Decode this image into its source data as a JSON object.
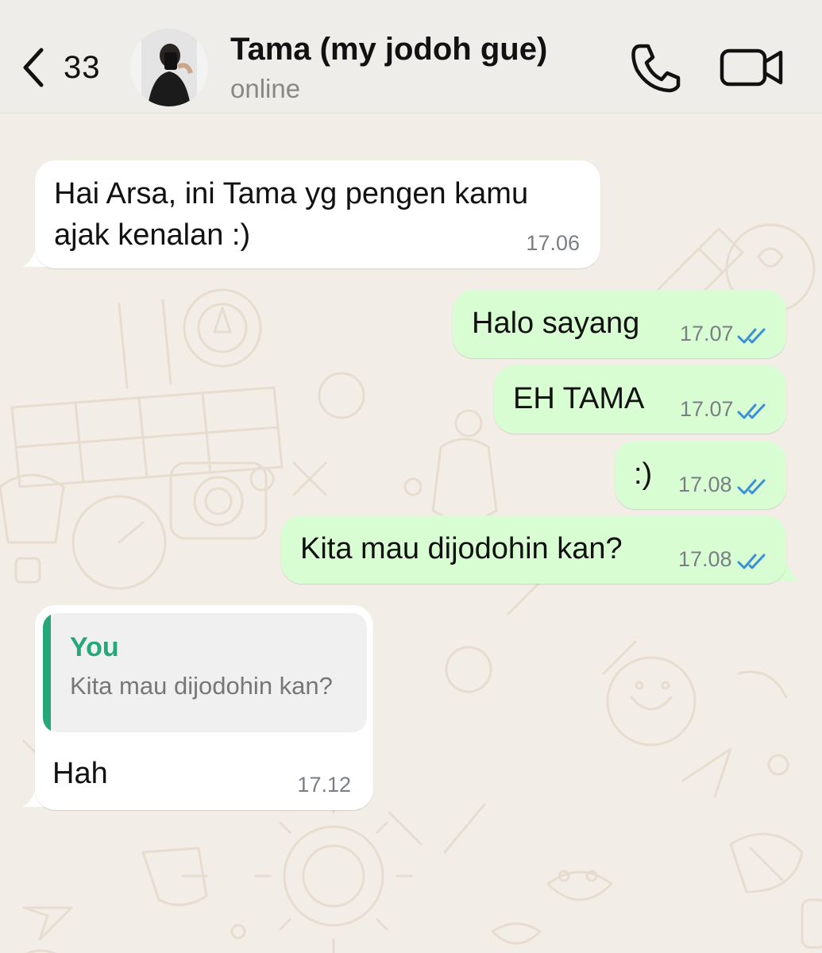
{
  "header": {
    "back_count": "33",
    "contact_name": "Tama (my jodoh gue)",
    "status": "online"
  },
  "messages": [
    {
      "direction": "incoming",
      "line1": "Hai Arsa, ini Tama yg pengen kamu",
      "line2": "ajak kenalan :)",
      "time": "17.06"
    },
    {
      "direction": "outgoing",
      "text": "Halo sayang",
      "time": "17.07",
      "status": "read"
    },
    {
      "direction": "outgoing",
      "text": "EH TAMA",
      "time": "17.07",
      "status": "read"
    },
    {
      "direction": "outgoing",
      "text": ":)",
      "time": "17.08",
      "status": "read"
    },
    {
      "direction": "outgoing",
      "text": "Kita mau dijodohin kan?",
      "time": "17.08",
      "status": "read"
    },
    {
      "direction": "incoming",
      "reply_to": {
        "author": "You",
        "text": "Kita mau dijodohin kan?"
      },
      "text": "Hah",
      "time": "17.12"
    }
  ],
  "colors": {
    "outgoing_bubble": "#d9fdd3",
    "incoming_bubble": "#ffffff",
    "read_ticks": "#3a8fd6",
    "reply_accent": "#25a77a",
    "wallpaper": "#f2ede6"
  }
}
